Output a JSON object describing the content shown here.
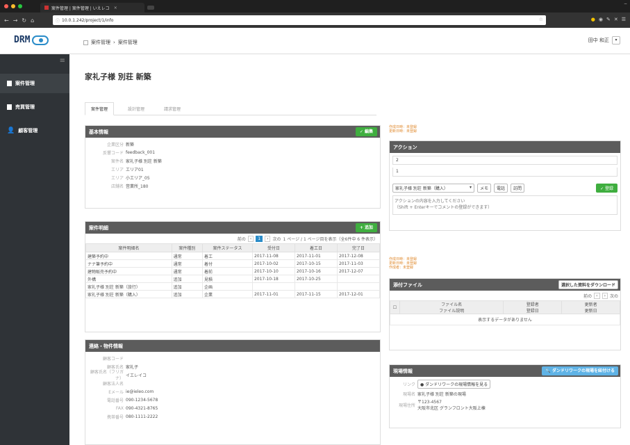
{
  "browser": {
    "tab_title": "案件管理 | 案件管理 | いえレコ",
    "url": "10.0.1.242/project/1/info",
    "close": "×",
    "win_controls": "−"
  },
  "header": {
    "logo": "DRM",
    "breadcrumb": [
      "案件管理",
      "案件管理"
    ],
    "breadcrumb_sep": "›",
    "user": "田中 和正",
    "user_dropdown": "▾"
  },
  "sidebar": {
    "items": [
      {
        "label": "案件管理",
        "active": true
      },
      {
        "label": "売買管理",
        "active": false
      },
      {
        "label": "顧客管理",
        "active": false
      }
    ]
  },
  "page": {
    "title": "家礼子様 別荘 新築"
  },
  "tabs": [
    {
      "label": "案件管理",
      "active": true
    },
    {
      "label": "設計管理",
      "active": false
    },
    {
      "label": "請求管理",
      "active": false
    }
  ],
  "basic": {
    "title": "基本情報",
    "edit": "✓ 編集",
    "rows": [
      {
        "k": "企業区分",
        "v": "新築"
      },
      {
        "k": "反響コード",
        "v": "feedback_001"
      },
      {
        "k": "案件名",
        "v": "家礼子様 別荘 新築"
      },
      {
        "k": "エリア",
        "v": "エリア01"
      },
      {
        "k": "エリア",
        "v": "小エリア_05"
      },
      {
        "k": "店舗名",
        "v": "営業所_180"
      }
    ]
  },
  "cases": {
    "title": "案件明細",
    "add": "+ 追加",
    "pager": {
      "prev": "前の",
      "cur": "1",
      "next": "次の",
      "info": "1 ページ / 1 ページ目を表示（全6件中 6 件表示）"
    },
    "headers": [
      "案件明細名",
      "案件種別",
      "案件ステータス",
      "受付日",
      "着工日",
      "完了日"
    ],
    "rows": [
      [
        "建築予約中",
        "通常",
        "着工",
        "2017-11-08",
        "2017-11-01",
        "2017-12-08"
      ],
      [
        "ナナ筆予約中",
        "通常",
        "着付",
        "2017-10-02",
        "2017-10-15",
        "2017-11-03"
      ],
      [
        "建物販売予約中",
        "通常",
        "着前",
        "2017-10-10",
        "2017-10-16",
        "2017-12-07"
      ],
      [
        "外構",
        "追加",
        "見積",
        "2017-10-18",
        "2017-10-25",
        ""
      ],
      [
        "家礼子様 別荘 新築（旅行）",
        "追加",
        "企画",
        "",
        "",
        ""
      ],
      [
        "家礼子様 別荘 新築（購入）",
        "追加",
        "企業",
        "2017-11-01",
        "2017-11-15",
        "2017-12-01"
      ]
    ]
  },
  "contact": {
    "title": "連絡・物件情報",
    "rows": [
      {
        "k": "顧客コード",
        "v": ""
      },
      {
        "k": "顧客氏名",
        "v": "家礼子"
      },
      {
        "k": "顧客氏名（フリガナ）",
        "v": "イエレイコ"
      },
      {
        "k": "顧客法人名",
        "v": ""
      },
      {
        "k": "Eメール",
        "v": "ie@ieleo.com"
      },
      {
        "k": "電話番号",
        "v": "090-1234-5678"
      },
      {
        "k": "FAX",
        "v": "090-4321-8765"
      },
      {
        "k": "携帯番号",
        "v": "080-1111-2222"
      }
    ]
  },
  "action": {
    "notes": [
      "作成日時：未登録",
      "更新日時：未登録"
    ],
    "title": "アクション",
    "items": [
      "2",
      "1"
    ],
    "select": "家礼子様 別荘 新築（購入）",
    "select_caret": "▾",
    "buttons": [
      "メモ",
      "電話",
      "訪問"
    ],
    "save": "✓ 登録",
    "placeholder": "アクションの内容を入力してください\n（Shift + Enterキーでコメントの登録ができます）"
  },
  "files": {
    "notes": [
      "作成日時：未登録",
      "更新日時：未登録",
      "作成者：未登録"
    ],
    "title": "添付ファイル",
    "download": "選択した資料をダウンロード",
    "pager": {
      "prev": "前の",
      "next": "次の"
    },
    "headers": [
      "ファイル名",
      "登録者",
      "登録日",
      "ファイル説明",
      "更新者",
      "更新日"
    ],
    "empty": "表示するデータがありません"
  },
  "site": {
    "title": "現場情報",
    "link": "ダンドリワークの現場を紐付ける",
    "rows": [
      {
        "k": "リンク",
        "v": "ダンドリワークの現場情報を見る",
        "btn": true
      },
      {
        "k": "現場名",
        "v": "家礼子様 別荘 新築の現場"
      },
      {
        "k": "現場住所",
        "v": "〒123-4567\n大阪市北区 グランフロント大阪上棟"
      }
    ]
  },
  "colors": {
    "sidebar": "#2f3337",
    "panel_header": "#5c5c5c",
    "green": "#3fae3f",
    "blue": "#5fb3e6"
  }
}
